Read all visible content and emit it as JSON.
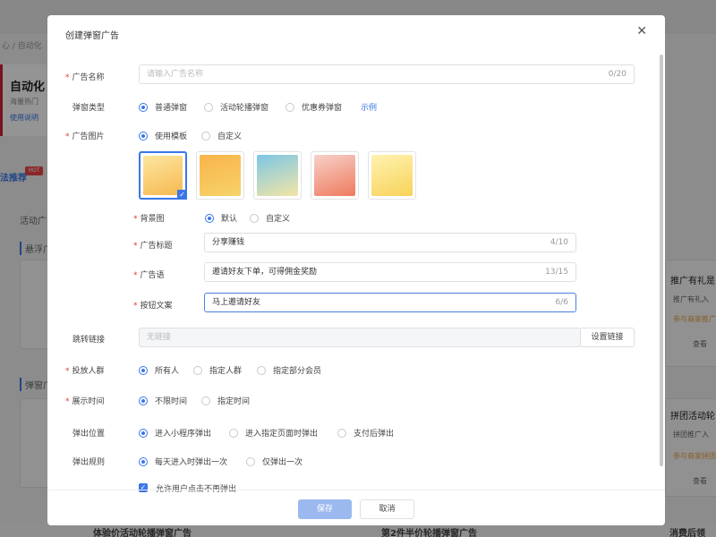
{
  "background": {
    "crumb": "心 / 自动化",
    "hero_title": "自动化",
    "hero_sub": "海量热门",
    "hero_link": "使用说明",
    "section_title": "法推荐",
    "hot_tag": "HOT",
    "tab_label": "活动广",
    "group1": "悬浮广",
    "group2": "弹窗广",
    "right_title1": "推广有礼是",
    "right_sub1": "推广有礼入",
    "right_sub1b": "参与商家推广",
    "right_btn1": "查看",
    "right_title2": "拼团活动轮",
    "right_sub2": "拼团推广入",
    "right_sub2b": "参与商家拼团",
    "right_btn2": "查看",
    "bottom_card1": "体验价活动轮播弹窗广告",
    "bottom_card2": "第2件半价轮播弹窗广告",
    "bottom_card3": "消费后领"
  },
  "dialog": {
    "title": "创建弹窗广告",
    "close_icon": "close-icon",
    "ad_name": {
      "label": "广告名称",
      "placeholder": "请输入广告名称",
      "count": "0/20"
    },
    "popup_type": {
      "label": "弹窗类型",
      "options": [
        "普通弹窗",
        "活动轮播弹窗",
        "优惠券弹窗"
      ],
      "selected": 0,
      "example_link": "示例"
    },
    "ad_image": {
      "label": "广告图片",
      "options": [
        "使用模板",
        "自定义"
      ],
      "selected": 0
    },
    "thumbnails_colors": [
      "#f6c85a",
      "#f2a04a",
      "#8fd0e8",
      "#f08a6a",
      "#f9e27a"
    ],
    "background": {
      "label": "背景图",
      "options": [
        "默认",
        "自定义"
      ],
      "selected": 0
    },
    "ad_title": {
      "label": "广告标题",
      "value": "分享赚钱",
      "count": "4/10"
    },
    "ad_slogan": {
      "label": "广告语",
      "value": "邀请好友下单，可得佣金奖励",
      "count": "13/15"
    },
    "button_text": {
      "label": "按钮文案",
      "value": "马上邀请好友",
      "count": "6/6"
    },
    "jump_link": {
      "label": "跳转链接",
      "placeholder": "无链接",
      "button": "设置链接"
    },
    "audience": {
      "label": "投放人群",
      "options": [
        "所有人",
        "指定人群",
        "指定部分会员"
      ],
      "selected": 0
    },
    "display_time": {
      "label": "展示时间",
      "options": [
        "不限时间",
        "指定时间"
      ],
      "selected": 0
    },
    "popup_position": {
      "label": "弹出位置",
      "options": [
        "进入小程序弹出",
        "进入指定页面时弹出",
        "支付后弹出"
      ],
      "selected": 0
    },
    "popup_rule": {
      "label": "弹出规则",
      "options": [
        "每天进入时弹出一次",
        "仅弹出一次"
      ],
      "selected": 0
    },
    "allow_close": {
      "label": "允许用户点击不再弹出",
      "checked": true
    },
    "save_button": "保存",
    "cancel_button": "取消"
  }
}
